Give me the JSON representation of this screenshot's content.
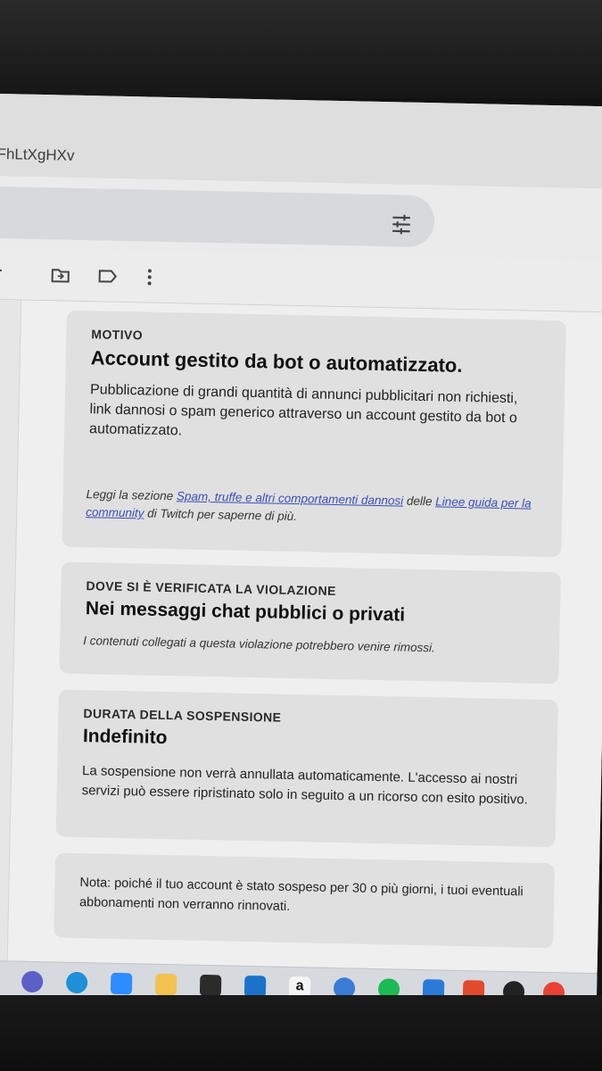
{
  "browser": {
    "url_fragment": "FhLtXgHXv"
  },
  "header": {
    "filter_icon": "tune-icon"
  },
  "toolbar": {
    "icons": [
      "add-icon",
      "move-to-icon",
      "label-icon",
      "more-vert-icon"
    ]
  },
  "cards": {
    "reason": {
      "label": "MOTIVO",
      "title": "Account gestito da bot o automatizzato.",
      "body": "Pubblicazione di grandi quantità di annunci pubblicitari non richiesti, link dannosi o spam generico attraverso un account gestito da bot o automatizzato.",
      "note_prefix": "Leggi la sezione ",
      "note_link1": "Spam, truffe e altri comportamenti dannosi",
      "note_mid": " delle ",
      "note_link2": "Linee guida per la community",
      "note_suffix": " di Twitch per saperne di più."
    },
    "location": {
      "label": "DOVE SI È VERIFICATA LA VIOLAZIONE",
      "title": "Nei messaggi chat pubblici o privati",
      "note": "I contenuti collegati a questa violazione potrebbero venire rimossi."
    },
    "duration": {
      "label": "DURATA DELLA SOSPENSIONE",
      "title": "Indefinito",
      "body": "La sospensione non verrà annullata automaticamente. L'accesso ai nostri servizi può essere ripristinato solo in seguito a un ricorso con esito positivo."
    },
    "notice": {
      "body": "Nota: poiché il tuo account è stato sospeso per 30 o più giorni, i tuoi eventuali abbonamenti non verranno rinnovati."
    }
  },
  "taskbar": {
    "apps": [
      "teams-icon",
      "edge-icon",
      "zoom-icon",
      "file-explorer-icon",
      "microsoft-store-icon",
      "mail-icon",
      "amazon-icon",
      "settings-icon",
      "spotify-icon",
      "vscode-icon",
      "office-icon",
      "media-player-icon",
      "chrome-icon"
    ]
  },
  "colors": {
    "link": "#3b4fb8",
    "card_bg": "#e0e0e0",
    "page_bg": "#efefef"
  }
}
